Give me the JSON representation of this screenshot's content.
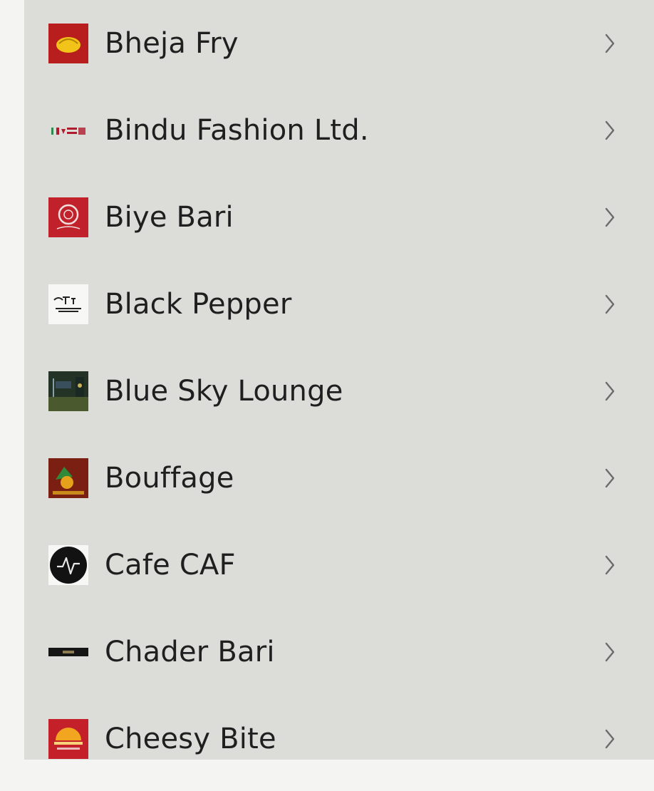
{
  "list": {
    "items": [
      {
        "label": "Bheja Fry",
        "logo": "bheja-fry-logo",
        "chevron": "chevron-right-icon"
      },
      {
        "label": "Bindu Fashion Ltd.",
        "logo": "bindu-fashion-logo",
        "chevron": "chevron-right-icon"
      },
      {
        "label": "Biye Bari",
        "logo": "biye-bari-logo",
        "chevron": "chevron-right-icon"
      },
      {
        "label": "Black Pepper",
        "logo": "black-pepper-logo",
        "chevron": "chevron-right-icon"
      },
      {
        "label": "Blue Sky Lounge",
        "logo": "blue-sky-lounge-logo",
        "chevron": "chevron-right-icon"
      },
      {
        "label": "Bouffage",
        "logo": "bouffage-logo",
        "chevron": "chevron-right-icon"
      },
      {
        "label": "Cafe CAF",
        "logo": "cafe-caf-logo",
        "chevron": "chevron-right-icon"
      },
      {
        "label": "Chader Bari",
        "logo": "chader-bari-logo",
        "chevron": "chevron-right-icon"
      },
      {
        "label": "Cheesy Bite",
        "logo": "cheesy-bite-logo",
        "chevron": "chevron-right-icon"
      }
    ]
  },
  "colors": {
    "list_background": "#dcdcd8",
    "text": "#1f1f1f",
    "chevron": "#6b6b6b"
  }
}
